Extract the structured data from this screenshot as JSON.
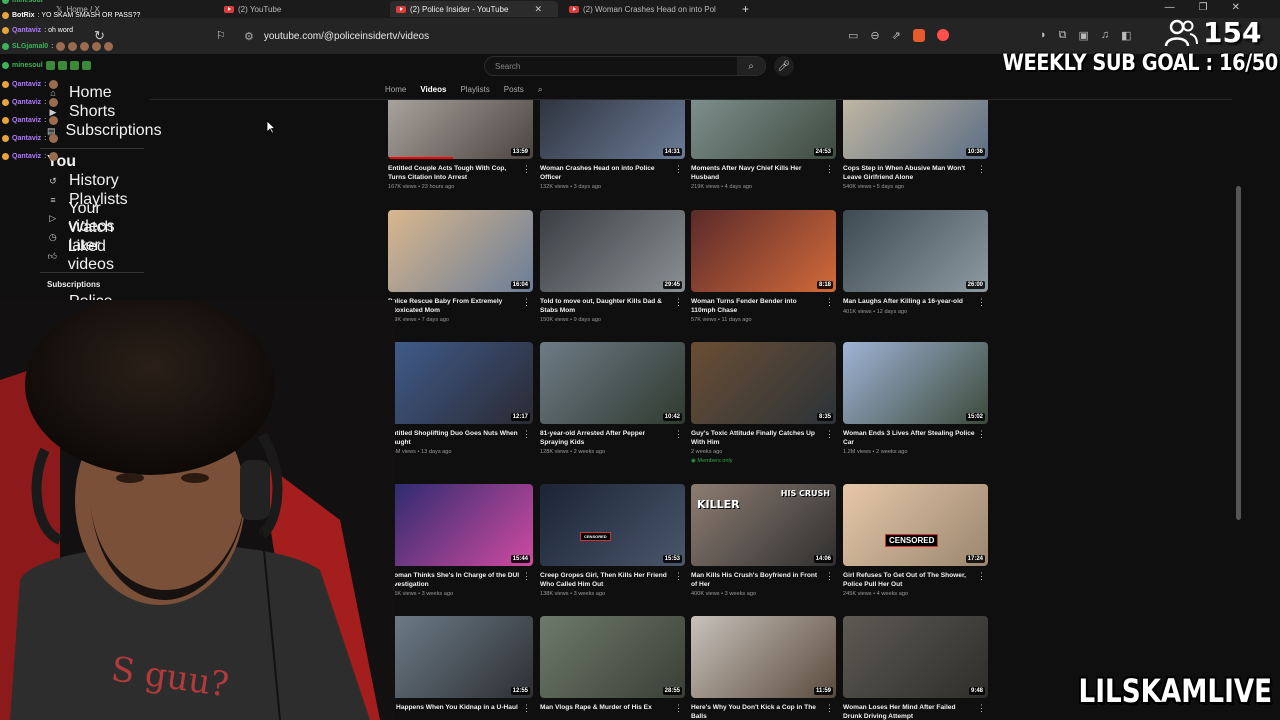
{
  "browser": {
    "tabs": [
      {
        "label": "Home / X"
      },
      {
        "label": "(2) YouTube"
      },
      {
        "label": "(2) Police Insider - YouTube"
      },
      {
        "label": "(2) Woman Crashes Head on into Pol"
      }
    ],
    "new_tab": "+",
    "url": "youtube.com/@policeinsidertv/videos"
  },
  "youtube": {
    "search_placeholder": "Search",
    "channel_tabs": [
      "Home",
      "Videos",
      "Playlists",
      "Posts"
    ],
    "sidebar": {
      "items": [
        "Home",
        "Shorts",
        "Subscriptions",
        "You",
        "History",
        "Playlists",
        "Your videos",
        "Watch later",
        "Liked videos"
      ],
      "subscriptions_title": "Subscriptions",
      "subscription_channel": "Police"
    },
    "videos": [
      {
        "title": "Entitled Couple Acts Tough With Cop, Turns Citation Into Arrest",
        "meta": "167K views • 23 hours ago",
        "duration": "13:59"
      },
      {
        "title": "Woman Crashes Head on into Police Officer",
        "meta": "132K views • 3 days ago",
        "duration": "14:31"
      },
      {
        "title": "Moments After Navy Chief Kills Her Husband",
        "meta": "219K views • 4 days ago",
        "duration": "24:53"
      },
      {
        "title": "Cops Step in When Abusive Man Won't Leave Girlfriend Alone",
        "meta": "540K views • 5 days ago",
        "duration": "10:36"
      },
      {
        "title": "Police Rescue Baby From Extremely Intoxicated Mom",
        "meta": "249K views • 7 days ago",
        "duration": "16:04"
      },
      {
        "title": "Told to move out, Daughter Kills Dad & Stabs Mom",
        "meta": "150K views • 9 days ago",
        "duration": "29:45"
      },
      {
        "title": "Woman Turns Fender Bender into 110mph Chase",
        "meta": "57K views • 11 days ago",
        "duration": "8:18"
      },
      {
        "title": "Man Laughs After Killing a 16-year-old",
        "meta": "401K views • 12 days ago",
        "duration": "26:00"
      },
      {
        "title": "Entitled Shoplifting Duo Goes Nuts When Caught",
        "meta": "1.4M views • 13 days ago",
        "duration": "12:17"
      },
      {
        "title": "81-year-old Arrested After Pepper Spraying Kids",
        "meta": "128K views • 2 weeks ago",
        "duration": "10:42"
      },
      {
        "title": "Guy's Toxic Attitude Finally Catches Up With Him",
        "meta": "2 weeks ago",
        "duration": "8:35",
        "badge": "Members only"
      },
      {
        "title": "Woman Ends 3 Lives After Stealing Police Car",
        "meta": "1.2M views • 2 weeks ago",
        "duration": "15:02"
      },
      {
        "title": "Woman Thinks She's In Charge of the DUI Investigation",
        "meta": "155K views • 3 weeks ago",
        "duration": "15:44"
      },
      {
        "title": "Creep Gropes Girl, Then Kills Her Friend Who Called Him Out",
        "meta": "138K views • 3 weeks ago",
        "duration": "15:53"
      },
      {
        "title": "Man Kills His Crush's Boyfriend in Front of Her",
        "meta": "400K views • 3 weeks ago",
        "duration": "14:06"
      },
      {
        "title": "Girl Refuses To Get Out of The Shower, Police Pull Her Out",
        "meta": "245K views • 4 weeks ago",
        "duration": "17:24"
      },
      {
        "title": "nt Happens When You Kidnap in a U-Haul",
        "meta": "",
        "duration": "12:55"
      },
      {
        "title": "Man Vlogs Rape & Murder of His Ex",
        "meta": "",
        "duration": "28:55"
      },
      {
        "title": "Here's Why You Don't Kick a Cop in The Balls",
        "meta": "",
        "duration": "11:59"
      },
      {
        "title": "Woman Loses Her Mind After Failed Drunk Driving Attempt",
        "meta": "",
        "duration": "9:48"
      }
    ],
    "thumb_texts": {
      "killer": "KILLER",
      "his_crush": "HIS CRUSH",
      "censored": "CENSORED",
      "censored_small": "CENSORED"
    }
  },
  "stream": {
    "chat": [
      {
        "user": "minesoul",
        "text": "",
        "color": "#3db35b"
      },
      {
        "user": "BotRix",
        "text": ": YO SKAM SMASH OR PASS??",
        "color": "#ffffff"
      },
      {
        "user": "Qantaviz",
        "text": ": oh word",
        "color": "#b27aff"
      },
      {
        "user": "SLGjamal0",
        "text": ":",
        "color": "#3db35b"
      },
      {
        "user": "minesoul",
        "text": "",
        "color": "#3db35b"
      },
      {
        "user": "Qantaviz",
        "text": ":",
        "color": "#b27aff"
      },
      {
        "user": "Qantaviz",
        "text": ":",
        "color": "#b27aff"
      },
      {
        "user": "Qantaviz",
        "text": ":",
        "color": "#b27aff"
      },
      {
        "user": "Qantaviz",
        "text": ":",
        "color": "#b27aff"
      },
      {
        "user": "Qantaviz",
        "text": ":",
        "color": "#b27aff"
      }
    ],
    "viewer_count": "154",
    "sub_goal": "WEEKLY SUB GOAL : 16/50",
    "streamer_name": "LILSKAMLIVE"
  }
}
